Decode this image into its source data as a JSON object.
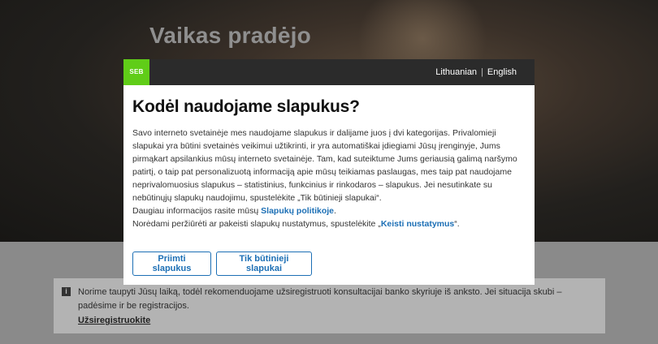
{
  "background": {
    "hero_title": "Vaikas pradėjo",
    "notice": {
      "icon": "info-icon",
      "text": "Norime taupyti Jūsų laiką, todėl rekomenduojame užsiregistruoti konsultacijai banko skyriuje iš anksto. Jei situacija skubi – padėsime ir be registracijos.",
      "link": "Užsiregistruokite"
    }
  },
  "modal": {
    "logo": "SEB",
    "languages": {
      "lt": "Lithuanian",
      "separator": "|",
      "en": "English"
    },
    "title": "Kodėl naudojame slapukus?",
    "paragraph": "Savo interneto svetainėje mes naudojame slapukus ir dalijame juos į dvi kategorijas. Privalomieji slapukai yra būtini svetainės veikimui užtikrinti, ir yra automatiškai įdiegiami Jūsų įrenginyje, Jums pirmąkart apsilankius mūsų interneto svetainėje. Tam, kad suteiktume Jums geriausią galimą naršymo patirtį, o taip pat personalizuotą informaciją apie mūsų teikiamas paslaugas, mes taip pat naudojame neprivalomuosius slapukus – statistinius, funkcinius ir rinkodaros – slapukus. Jei nesutinkate su nebūtinųjų slapukų naudojimu, spustelėkite „Tik būtinieji slapukai“.",
    "policy_prefix": "Daugiau informacijos rasite mūsų ",
    "policy_link": "Slapukų politikoje",
    "policy_suffix": ".",
    "settings_prefix": "Norėdami peržiūrėti ar pakeisti slapukų nustatymus, spustelėkite „",
    "settings_link": "Keisti nustatymus",
    "settings_suffix": "“.",
    "accept_button": "Priimti slapukus",
    "necessary_button": "Tik būtinieji slapukai"
  },
  "colors": {
    "brand_green": "#60cd18",
    "link_blue": "#1c6fb5",
    "header_dark": "#2b2b2b"
  }
}
